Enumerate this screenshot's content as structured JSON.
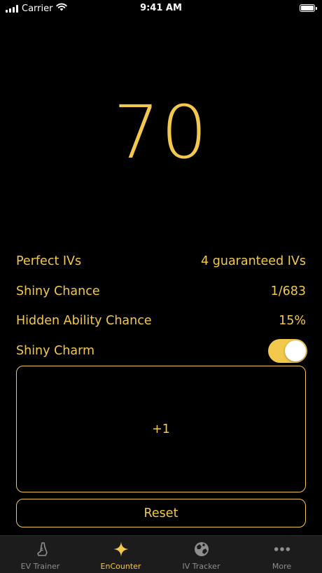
{
  "status_bar": {
    "carrier": "Carrier",
    "time": "9:41 AM"
  },
  "counter": {
    "value": "70"
  },
  "info": {
    "rows": [
      {
        "label": "Perfect IVs",
        "value": "4 guaranteed IVs"
      },
      {
        "label": "Shiny Chance",
        "value": "1/683"
      },
      {
        "label": "Hidden Ability Chance",
        "value": "15%"
      }
    ],
    "shiny_charm": {
      "label": "Shiny Charm",
      "enabled": true
    }
  },
  "buttons": {
    "increment_label": "+1",
    "reset_label": "Reset"
  },
  "tab_bar": {
    "tabs": [
      {
        "label": "EV Trainer",
        "icon": "shoe-icon",
        "active": false
      },
      {
        "label": "EnCounter",
        "icon": "sparkle-icon",
        "active": true
      },
      {
        "label": "IV Tracker",
        "icon": "globe-icon",
        "active": false
      },
      {
        "label": "More",
        "icon": "ellipsis-icon",
        "active": false
      }
    ]
  },
  "colors": {
    "accent": "#f2c94c",
    "background": "#000000",
    "tab_bar": "#1c1c1c",
    "inactive": "#8e8e8e"
  }
}
